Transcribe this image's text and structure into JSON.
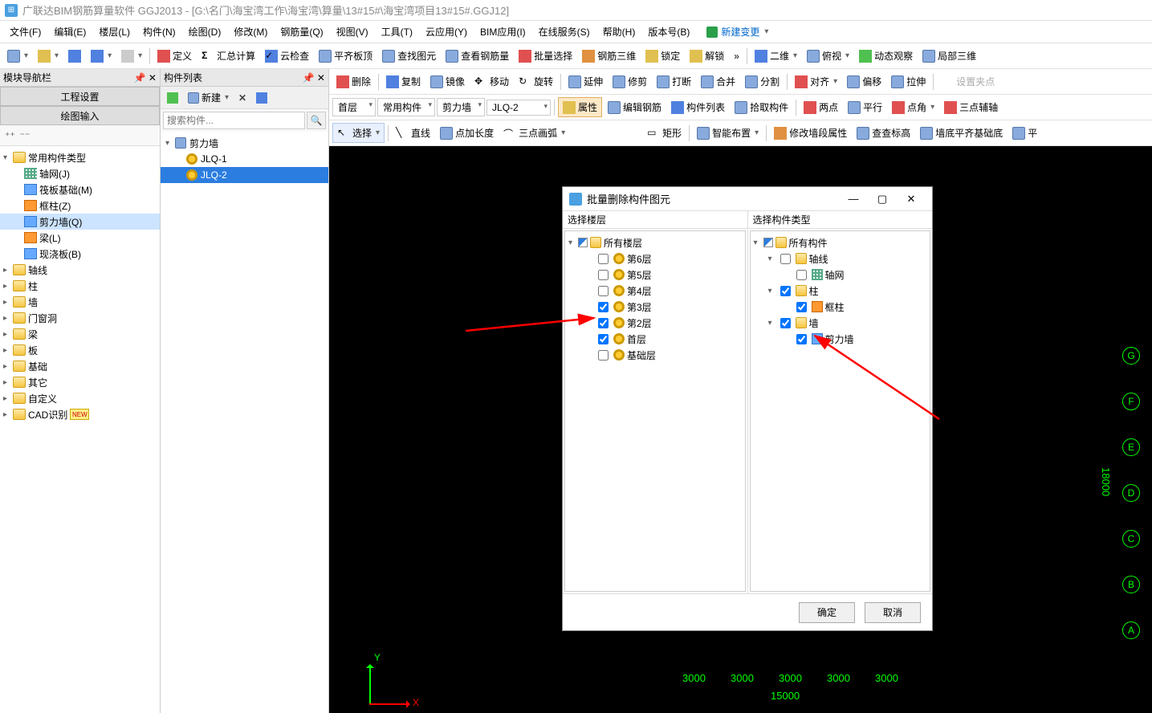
{
  "window": {
    "title": "广联达BIM钢筋算量软件 GGJ2013 - [G:\\名门\\海宝湾工作\\海宝湾\\算量\\13#15#\\海宝湾项目13#15#.GGJ12]"
  },
  "menu": {
    "items": [
      "文件(F)",
      "编辑(E)",
      "楼层(L)",
      "构件(N)",
      "绘图(D)",
      "修改(M)",
      "钢筋量(Q)",
      "视图(V)",
      "工具(T)",
      "云应用(Y)",
      "BIM应用(I)",
      "在线服务(S)",
      "帮助(H)",
      "版本号(B)"
    ],
    "new_change": "新建变更"
  },
  "toolbar1": {
    "define": "定义",
    "sum_calc": "汇总计算",
    "cloud_check": "云检查",
    "flat_top": "平齐板顶",
    "find_elem": "查找图元",
    "view_rebar": "查看钢筋量",
    "batch_select": "批量选择",
    "rebar_3d": "钢筋三维",
    "lock": "锁定",
    "unlock": "解锁",
    "view2d": "二维",
    "top_view": "俯视",
    "dyn_obs": "动态观察",
    "local_3d": "局部三维"
  },
  "toolbar2": {
    "delete": "删除",
    "copy": "复制",
    "mirror": "镜像",
    "move": "移动",
    "rotate": "旋转",
    "extend": "延伸",
    "trim": "修剪",
    "break": "打断",
    "merge": "合并",
    "split": "分割",
    "align": "对齐",
    "offset": "偏移",
    "stretch": "拉伸",
    "set_pts": "设置夹点"
  },
  "toolbar3": {
    "floor": "首层",
    "cat": "常用构件",
    "type": "剪力墙",
    "comp": "JLQ-2",
    "attrs": "属性",
    "edit_rebar": "编辑钢筋",
    "comp_list": "构件列表",
    "pick_comp": "拾取构件",
    "two_pt": "两点",
    "parallel": "平行",
    "pt_angle": "点角",
    "three_pt": "三点辅轴"
  },
  "toolbar4": {
    "select": "选择",
    "line": "直线",
    "pt_len": "点加长度",
    "arc3": "三点画弧",
    "rect": "矩形",
    "smart_layout": "智能布置",
    "edit_wall_attr": "修改墙段属性",
    "check_elev": "查查标高",
    "wall_base_flush": "墙底平齐基础底",
    "flush": "平"
  },
  "left_panel": {
    "title": "模块导航栏",
    "tab1": "工程设置",
    "tab2": "绘图输入",
    "tree": {
      "common": "常用构件类型",
      "common_children": [
        "轴网(J)",
        "筏板基础(M)",
        "框柱(Z)",
        "剪力墙(Q)",
        "梁(L)",
        "现浇板(B)"
      ],
      "cats": [
        "轴线",
        "柱",
        "墙",
        "门窗洞",
        "梁",
        "板",
        "基础",
        "其它",
        "自定义",
        "CAD识别"
      ]
    }
  },
  "mid_panel": {
    "title": "构件列表",
    "new": "新建",
    "search_placeholder": "搜索构件...",
    "root": "剪力墙",
    "items": [
      "JLQ-1",
      "JLQ-2"
    ]
  },
  "dialog": {
    "title": "批量删除构件图元",
    "col1": "选择楼层",
    "col2": "选择构件类型",
    "floors_root": "所有楼层",
    "floors": [
      "第6层",
      "第5层",
      "第4层",
      "第3层",
      "第2层",
      "首层",
      "基础层"
    ],
    "comps_root": "所有构件",
    "comp_axisline": "轴线",
    "comp_axisgrid": "轴网",
    "comp_column": "柱",
    "comp_framecol": "框柱",
    "comp_wall": "墙",
    "comp_shearwall": "剪力墙",
    "ok": "确定",
    "cancel": "取消"
  },
  "canvas": {
    "axis_labels": [
      "G",
      "F",
      "E",
      "D",
      "C",
      "B",
      "A"
    ],
    "dim_y": "18000",
    "dims_x": [
      "3000",
      "3000",
      "3000",
      "3000",
      "3000"
    ],
    "dim_x_total": "15000",
    "x_label": "X",
    "y_label": "Y"
  }
}
